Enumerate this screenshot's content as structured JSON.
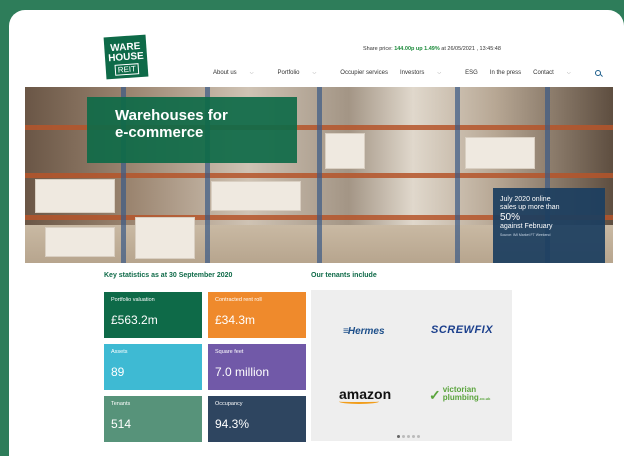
{
  "logo": {
    "line1": "WARE",
    "line2": "HOUSE",
    "line3": "REIT"
  },
  "share": {
    "prefix": "Share price:",
    "price": "144.00p up 1.49%",
    "suffix": "at 26/05/2021 , 13:45:48"
  },
  "nav": [
    {
      "label": "About us",
      "dropdown": true
    },
    {
      "label": "Portfolio",
      "dropdown": true
    },
    {
      "label": "Occupier services",
      "dropdown": false
    },
    {
      "label": "Investors",
      "dropdown": true
    },
    {
      "label": "ESG",
      "dropdown": false
    },
    {
      "label": "In the press",
      "dropdown": false
    },
    {
      "label": "Contact",
      "dropdown": true
    }
  ],
  "hero": {
    "title_line1": "Warehouses for",
    "title_line2": "e-commerce",
    "card": {
      "line1": "July 2020 online",
      "line2": "sales up more than",
      "stat": "50%",
      "line3": "against February",
      "source": "Source: IMI Market FT Weekend"
    }
  },
  "stats": {
    "heading": "Key statistics as at 30 September 2020",
    "items": [
      {
        "label": "Portfolio valuation",
        "value": "£563.2m",
        "color": "#0e6a48"
      },
      {
        "label": "Contracted rent roll",
        "value": "£34.3m",
        "color": "#ef8a2c"
      },
      {
        "label": "Assets",
        "value": "89",
        "color": "#3ebad3"
      },
      {
        "label": "Square feet",
        "value": "7.0 million",
        "color": "#7159a8"
      },
      {
        "label": "Tenants",
        "value": "514",
        "color": "#57937a"
      },
      {
        "label": "Occupancy",
        "value": "94.3%",
        "color": "#2e4560"
      }
    ]
  },
  "tenants": {
    "heading": "Our tenants include",
    "logos": [
      {
        "name": "Hermes"
      },
      {
        "name": "SCREWFIX"
      },
      {
        "name": "amazon"
      },
      {
        "name_line1": "victorian",
        "name_line2": "plumbing",
        "suffix": ".co.uk"
      }
    ]
  }
}
